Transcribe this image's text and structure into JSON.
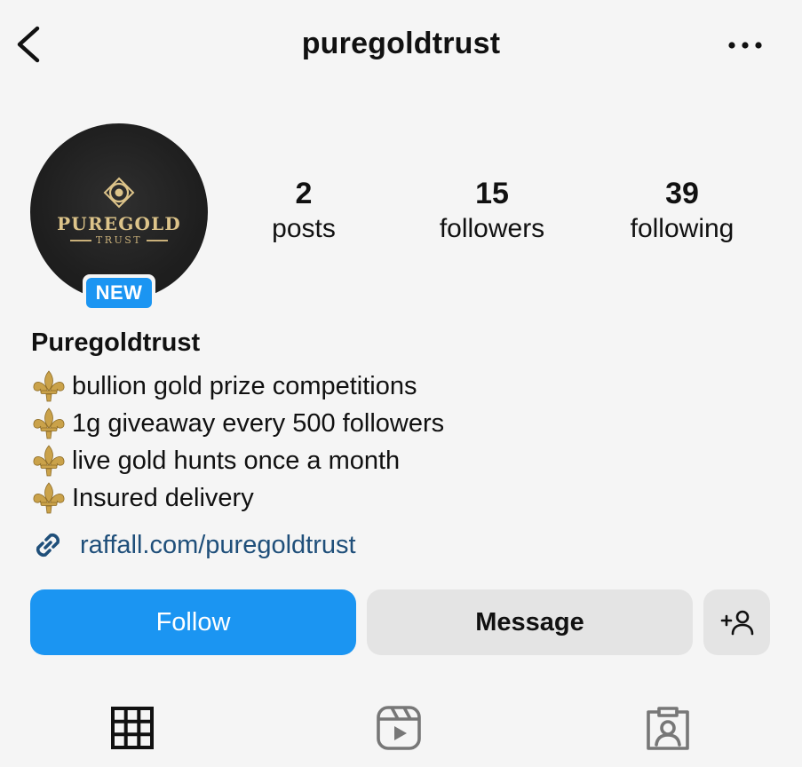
{
  "header": {
    "username": "puregoldtrust",
    "back_icon": "chevron-left-icon",
    "more_icon": "more-horizontal-icon"
  },
  "avatar": {
    "logo_main": "PUREGOLD",
    "logo_sub": "TRUST",
    "badge": "NEW"
  },
  "stats": {
    "posts": {
      "count": "2",
      "label": "posts"
    },
    "followers": {
      "count": "15",
      "label": "followers"
    },
    "following": {
      "count": "39",
      "label": "following"
    }
  },
  "bio": {
    "display_name": "Puregoldtrust",
    "lines": [
      "bullion gold prize competitions",
      "1g giveaway every 500 followers",
      "live gold hunts once a month",
      "Insured delivery"
    ],
    "link": "raffall.com/puregoldtrust"
  },
  "actions": {
    "follow": "Follow",
    "message": "Message"
  },
  "tabs": [
    "grid-icon",
    "reels-icon",
    "tagged-icon"
  ],
  "colors": {
    "accent_blue": "#1b95f2",
    "link_blue": "#1f4f7a",
    "gold": "#ddc48a",
    "background": "#f5f5f5"
  }
}
